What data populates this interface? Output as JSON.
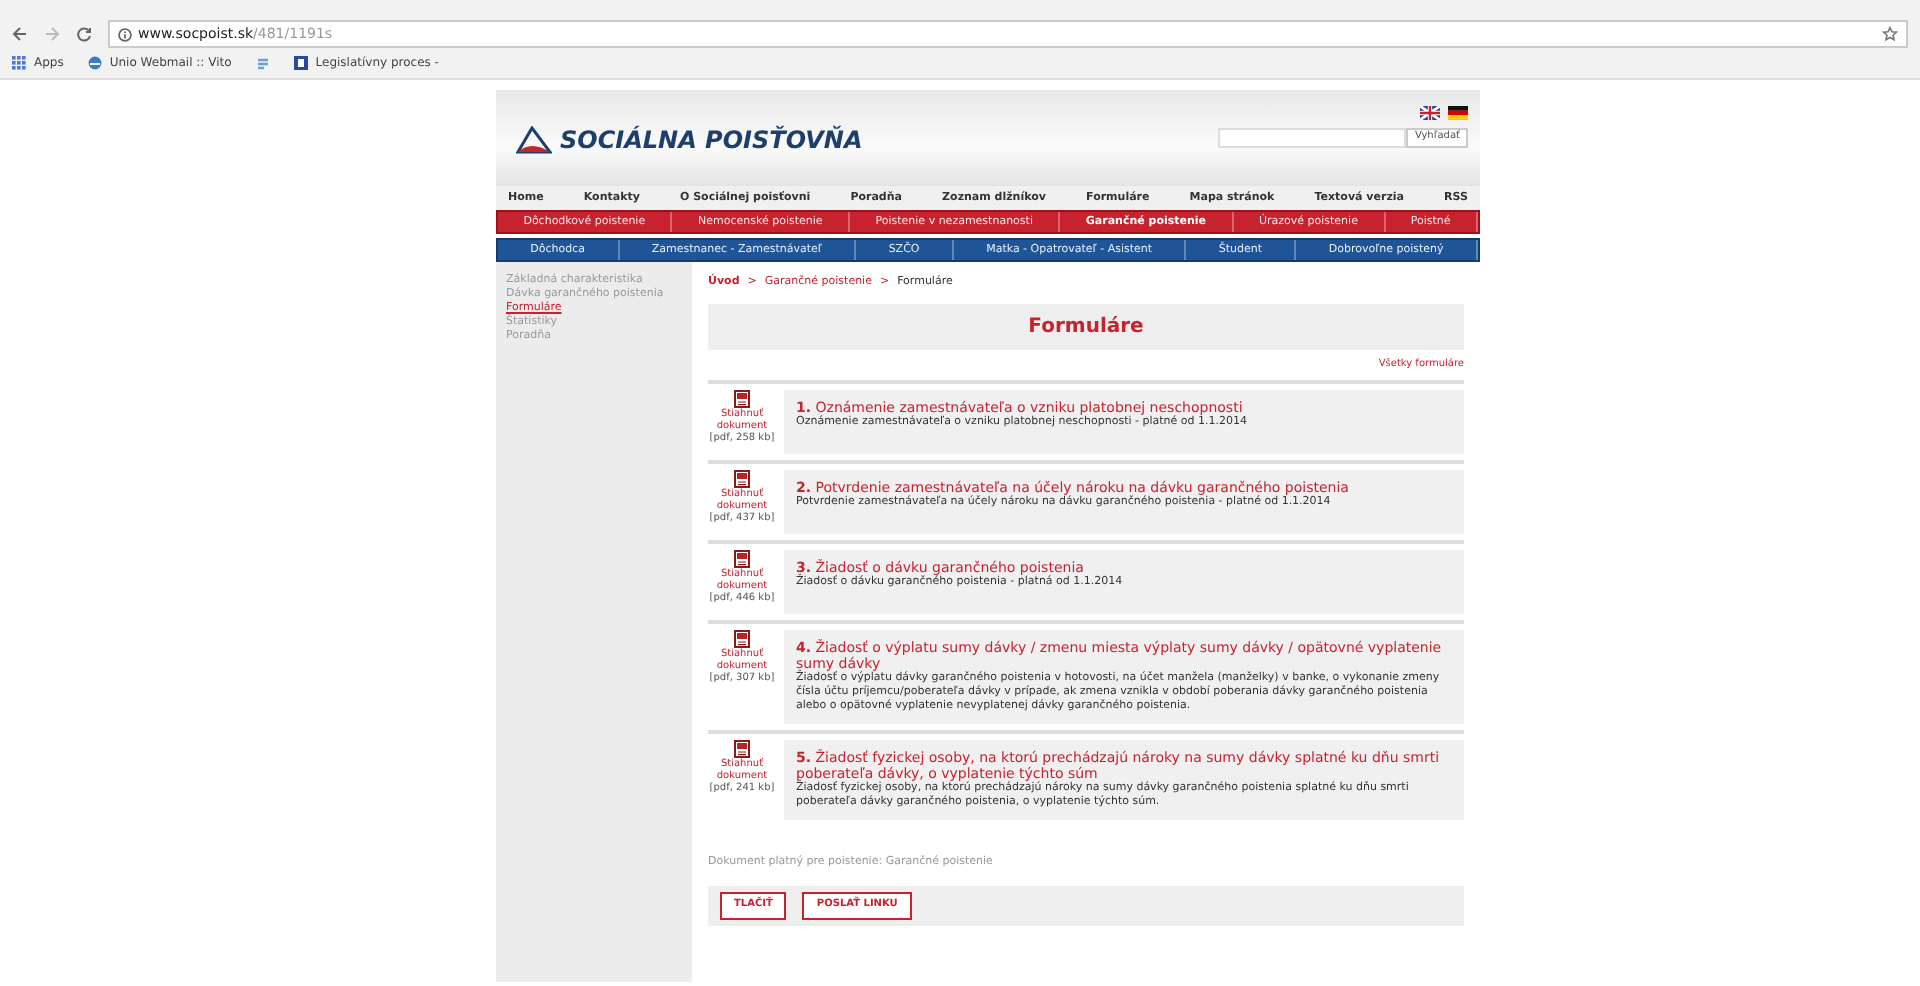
{
  "browser": {
    "url_domain": "www.socpoist.sk",
    "url_path": "/481/1191s",
    "bookmarks": [
      {
        "label": "Apps",
        "kind": "apps"
      },
      {
        "label": "Unio Webmail :: Vito",
        "kind": "mail"
      },
      {
        "kind": "plain"
      },
      {
        "label": "Legislatívny proces -",
        "kind": "doc"
      }
    ]
  },
  "header": {
    "logo": "SOCIÁLNA POISŤOVŇA",
    "search_button": "Vyhľadať"
  },
  "top_nav": [
    "Home",
    "Kontakty",
    "O Sociálnej poisťovni",
    "Poradňa",
    "Zoznam dlžníkov",
    "Formuláre",
    "Mapa stránok",
    "Textová verzia",
    "RSS"
  ],
  "red_menu": [
    {
      "label": "Dôchodkové poistenie",
      "selected": false
    },
    {
      "label": "Nemocenské poistenie",
      "selected": false
    },
    {
      "label": "Poistenie v nezamestnanosti",
      "selected": false
    },
    {
      "label": "Garančné poistenie",
      "selected": true
    },
    {
      "label": "Úrazové poistenie",
      "selected": false
    },
    {
      "label": "Poistné",
      "selected": false
    }
  ],
  "blue_menu": [
    "Dôchodca",
    "Zamestnanec - Zamestnávateľ",
    "SZČO",
    "Matka - Opatrovateľ - Asistent",
    "Študent",
    "Dobrovoľne poistený"
  ],
  "sidebar": [
    {
      "label": "Základná charakteristika",
      "selected": false
    },
    {
      "label": "Dávka garančného poistenia",
      "selected": false
    },
    {
      "label": "Formuláre",
      "selected": true
    },
    {
      "label": "Štatistiky",
      "selected": false
    },
    {
      "label": "Poradňa",
      "selected": false
    }
  ],
  "breadcrumb": [
    "Úvod",
    ">",
    "Garančné poistenie",
    ">",
    "Formuláre"
  ],
  "title": "Formuláre",
  "all_forms": "Všetky formuláre",
  "forms": [
    {
      "download": "Stiahnuť dokument",
      "size": "[pdf, 258 kb]",
      "number": "1.",
      "title": "Oznámenie zamestnávateľa o vzniku platobnej neschopnosti",
      "description": "Oznámenie zamestnávateľa o vzniku platobnej neschopnosti - platné od 1.1.2014"
    },
    {
      "download": "Stiahnuť dokument",
      "size": "[pdf, 437 kb]",
      "number": "2.",
      "title": "Potvrdenie zamestnávateľa na účely nároku na dávku garančného poistenia",
      "description": "Potvrdenie zamestnávateľa na účely nároku na dávku garančného poistenia - platné od 1.1.2014"
    },
    {
      "download": "Stiahnuť dokument",
      "size": "[pdf, 446 kb]",
      "number": "3.",
      "title": "Žiadosť o dávku garančného poistenia",
      "description": "Žiadosť o dávku garančného poistenia - platná od 1.1.2014"
    },
    {
      "download": "Stiahnuť dokument",
      "size": "[pdf, 307 kb]",
      "number": "4.",
      "title": "Žiadosť o výplatu sumy dávky / zmenu miesta výplaty sumy dávky / opätovné vyplatenie sumy dávky",
      "description": "Žiadosť o výplatu dávky garančného poistenia v hotovosti, na účet manžela (manželky) v banke, o vykonanie zmeny čísla účtu príjemcu/poberateľa dávky v prípade, ak zmena vznikla v období poberania dávky garančného poistenia alebo o opätovné vyplatenie nevyplatenej dávky garančného poistenia."
    },
    {
      "download": "Stiahnuť dokument",
      "size": "[pdf, 241 kb]",
      "number": "5.",
      "title": "Žiadosť fyzickej osoby, na ktorú prechádzajú nároky na sumy dávky splatné ku dňu smrti poberateľa dávky, o vyplatenie týchto súm",
      "description": "Žiadosť fyzickej osoby, na ktorú prechádzajú nároky na sumy dávky garančného poistenia splatné ku dňu smrti poberateľa dávky garančného poistenia, o vyplatenie týchto súm."
    }
  ],
  "validity": {
    "label": "Dokument platný pre poistenie:",
    "link": "Garančné poistenie"
  },
  "actions": [
    "TLAČIŤ",
    "POSLAŤ LINKU"
  ]
}
